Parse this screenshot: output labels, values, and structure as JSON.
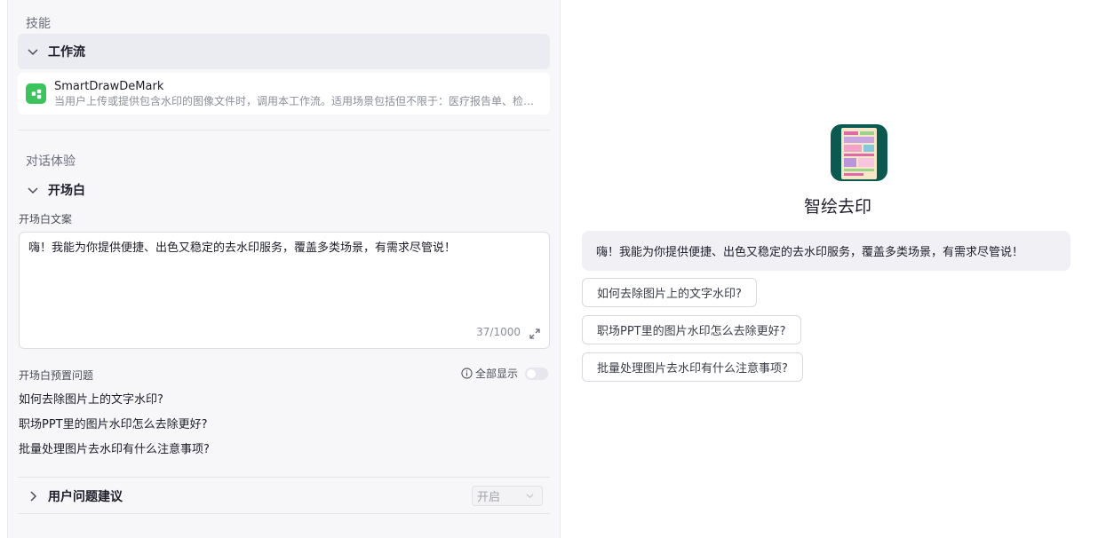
{
  "skills": {
    "section_title": "技能",
    "workflow_group": "工作流",
    "workflow": {
      "name": "SmartDrawDeMark",
      "description": "当用户上传或提供包含水印的图像文件时，调用本工作流。适用场景包括但不限于：医疗报告单、检…"
    }
  },
  "dialog": {
    "section_title": "对话体验",
    "opening_group": "开场白",
    "opening_text_label": "开场白文案",
    "opening_text": "嗨！我能为你提供便捷、出色又稳定的去水印服务，覆盖多类场景，有需求尽管说！",
    "counter": "37/1000",
    "preset_label": "开场白预置问题",
    "show_all_label": "全部显示",
    "presets": [
      "如何去除图片上的文字水印?",
      "职场PPT里的图片水印怎么去除更好?",
      "批量处理图片去水印有什么注意事项?"
    ],
    "suggestion_group": "用户问题建议",
    "suggestion_select": "开启"
  },
  "preview": {
    "bot_name": "智绘去印",
    "greeting": "嗨！我能为你提供便捷、出色又稳定的去水印服务，覆盖多类场景，有需求尽管说！",
    "suggestions": [
      "如何去除图片上的文字水印?",
      "职场PPT里的图片水印怎么去除更好?",
      "批量处理图片去水印有什么注意事项?"
    ]
  }
}
